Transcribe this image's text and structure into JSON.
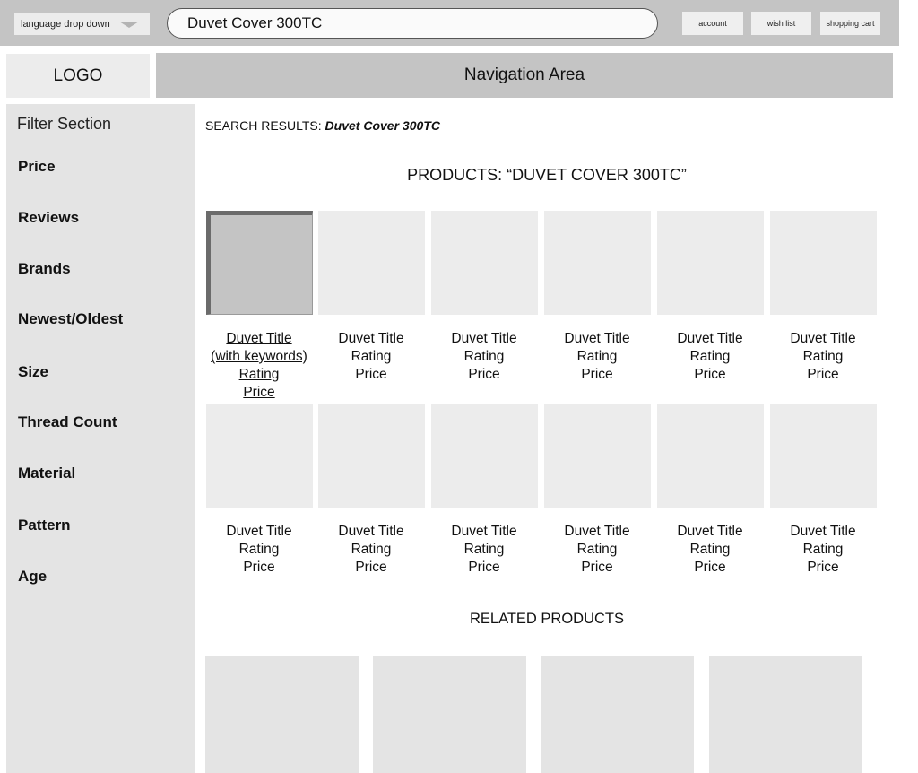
{
  "header": {
    "language_dropdown": {
      "label": "language drop down",
      "icon": "caret-down-icon"
    },
    "search": {
      "value": "Duvet Cover 300TC",
      "placeholder": ""
    },
    "buttons": {
      "account": "account",
      "wish_list": "wish list",
      "shopping_cart": "shopping cart"
    }
  },
  "logo": "LOGO",
  "navigation": "Navigation Area",
  "sidebar": {
    "title": "Filter Section",
    "filters": [
      "Price",
      "Reviews",
      "Brands",
      "Newest/Oldest",
      "Size",
      "Thread Count",
      "Material",
      "Pattern",
      "Age"
    ]
  },
  "main": {
    "search_results_label": "SEARCH RESULTS: ",
    "search_results_query": "Duvet Cover 300TC",
    "products_heading": "PRODUCTS: “DUVET COVER 300TC”",
    "products": [
      {
        "title": "Duvet Title",
        "subtitle": "(with keywords)",
        "rating": "Rating",
        "price": "Price",
        "selected": true
      },
      {
        "title": "Duvet Title",
        "rating": "Rating",
        "price": "Price"
      },
      {
        "title": "Duvet Title",
        "rating": "Rating",
        "price": "Price"
      },
      {
        "title": "Duvet Title",
        "rating": "Rating",
        "price": "Price"
      },
      {
        "title": "Duvet Title",
        "rating": "Rating",
        "price": "Price"
      },
      {
        "title": "Duvet Title",
        "rating": "Rating",
        "price": "Price"
      },
      {
        "title": "Duvet Title",
        "rating": "Rating",
        "price": "Price"
      },
      {
        "title": "Duvet Title",
        "rating": "Rating",
        "price": "Price"
      },
      {
        "title": "Duvet Title",
        "rating": "Rating",
        "price": "Price"
      },
      {
        "title": "Duvet Title",
        "rating": "Rating",
        "price": "Price"
      },
      {
        "title": "Duvet Title",
        "rating": "Rating",
        "price": "Price"
      },
      {
        "title": "Duvet Title",
        "rating": "Rating",
        "price": "Price"
      }
    ],
    "related_heading": "RELATED PRODUCTS",
    "related_count": 4
  },
  "colors": {
    "header_bg": "#c4c4c4",
    "nav_bg": "#c4c4c4",
    "logo_bg": "#ececec",
    "sidebar_bg": "#e4e4e4",
    "tile_bg": "#ececec",
    "tile_selected_bg": "#c4c4c4",
    "related_bg": "#e4e4e4"
  }
}
